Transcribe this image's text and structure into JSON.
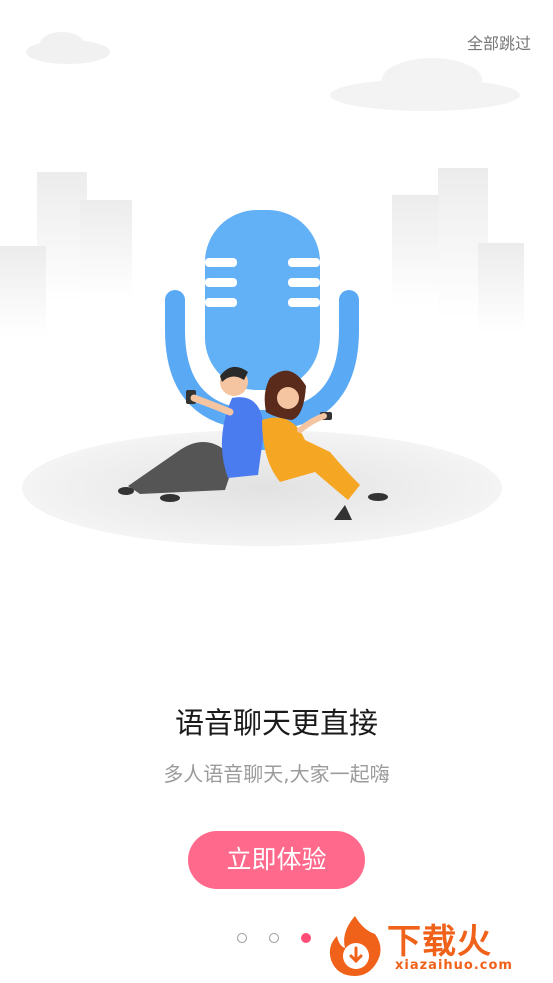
{
  "header": {
    "skip_all_label": "全部跳过"
  },
  "onboarding": {
    "title": "语音聊天更直接",
    "subtitle": "多人语音聊天,大家一起嗨",
    "cta_label": "立即体验",
    "page_count": 3,
    "active_page": 3
  },
  "watermark": {
    "title": "下载火",
    "url": "xiazaihuo.com"
  },
  "colors": {
    "cta": "#ff6a8c",
    "active_dot": "#ff4d78",
    "microphone": "#5aa9f4",
    "watermark": "#f0611a"
  },
  "icons": {
    "illustration": "microphone-with-couple-illustration",
    "watermark_logo": "flame-download-icon"
  }
}
